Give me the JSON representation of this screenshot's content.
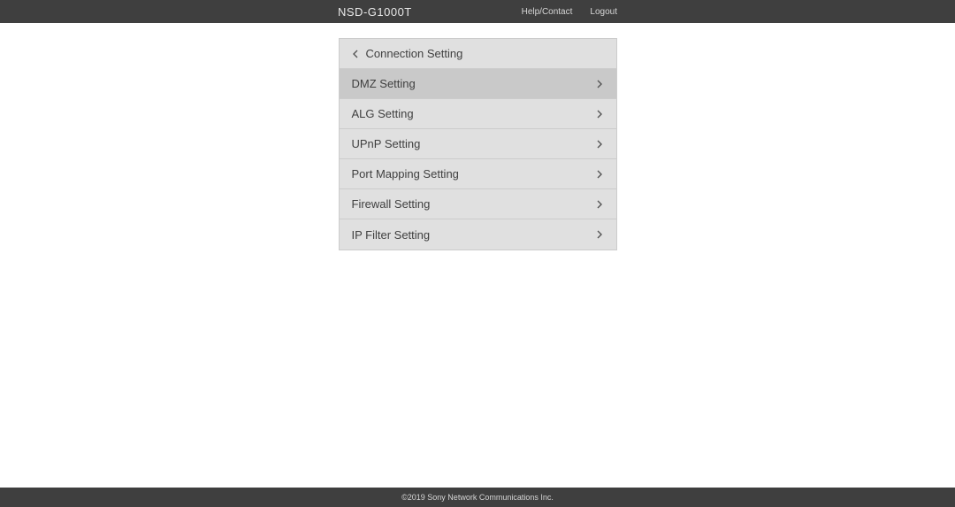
{
  "header": {
    "brand": "NSD-G1000T",
    "links": {
      "help": "Help/Contact",
      "logout": "Logout"
    }
  },
  "panel": {
    "title": "Connection Setting",
    "items": [
      {
        "label": "DMZ Setting",
        "active": true
      },
      {
        "label": "ALG Setting",
        "active": false
      },
      {
        "label": "UPnP Setting",
        "active": false
      },
      {
        "label": "Port Mapping Setting",
        "active": false
      },
      {
        "label": "Firewall Setting",
        "active": false
      },
      {
        "label": "IP Filter Setting",
        "active": false
      }
    ]
  },
  "footer": {
    "copyright": "©2019 Sony Network Communications Inc."
  }
}
